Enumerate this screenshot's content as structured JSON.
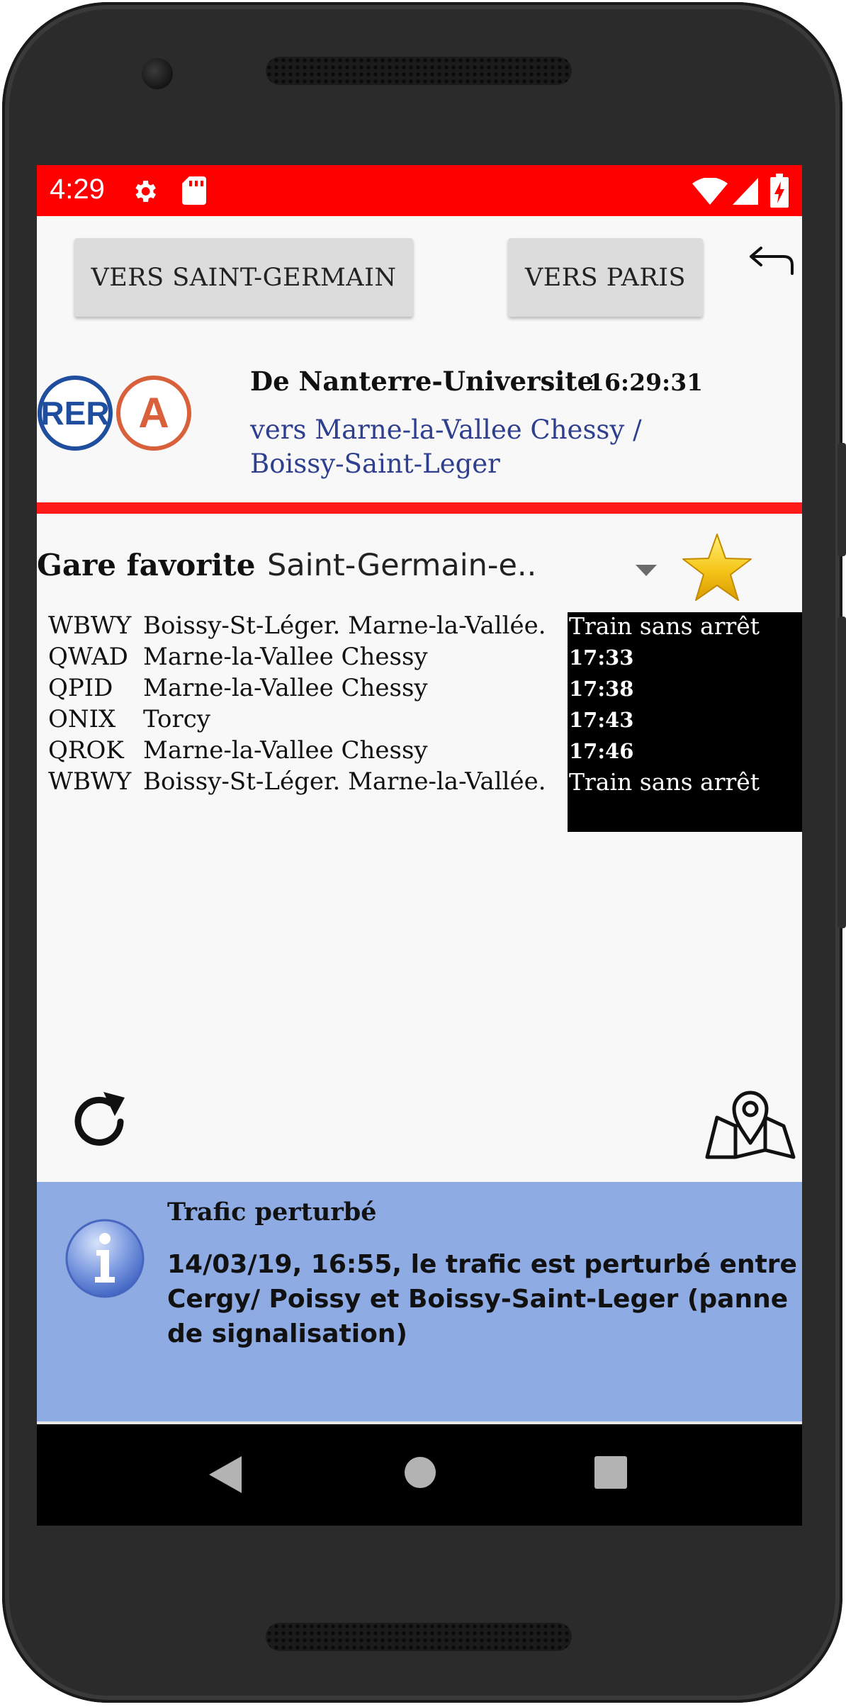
{
  "status_bar": {
    "time": "4:29",
    "icons": [
      "gear-icon",
      "sd-card-icon",
      "wifi-icon",
      "signal-icon",
      "battery-charging-icon"
    ]
  },
  "direction_buttons": {
    "saint_germain": "VERS SAINT-GERMAIN",
    "paris": "VERS PARIS"
  },
  "route": {
    "logo_rer": "RER",
    "logo_line": "A",
    "from": "De Nanterre-Universite",
    "time": "16:29:31",
    "to_line1": "vers Marne-la-Vallee Chessy /",
    "to_line2": "Boissy-Saint-Leger"
  },
  "favorite": {
    "label": "Gare favorite",
    "selected_station": "Saint-Germain-e.."
  },
  "trains": [
    {
      "code": "WBWY",
      "destination": "Boissy-St-Léger. Marne-la-Vallée.",
      "time": "Train sans arrêt"
    },
    {
      "code": "QWAD",
      "destination": "Marne-la-Vallee Chessy",
      "time": "17:33"
    },
    {
      "code": "QPID",
      "destination": "Marne-la-Vallee Chessy",
      "time": "17:38"
    },
    {
      "code": "ONIX",
      "destination": "Torcy",
      "time": "17:43"
    },
    {
      "code": "QROK",
      "destination": "Marne-la-Vallee Chessy",
      "time": "17:46"
    },
    {
      "code": "WBWY",
      "destination": "Boissy-St-Léger. Marne-la-Vallée.",
      "time": "Train sans arrêt"
    }
  ],
  "alert": {
    "title": "Trafic perturbé",
    "message": "14/03/19, 16:55, le trafic est perturbé entre Cergy/ Poissy et Boissy-Saint-Leger (panne de signalisation)"
  },
  "colors": {
    "status_bar": "#ff0000",
    "divider": "#ff1a1a",
    "rer_blue": "#1f4e9e",
    "line_a_orange": "#d8613c",
    "alert_bg": "#8eabe3",
    "destination_text": "#2e3f8f"
  }
}
